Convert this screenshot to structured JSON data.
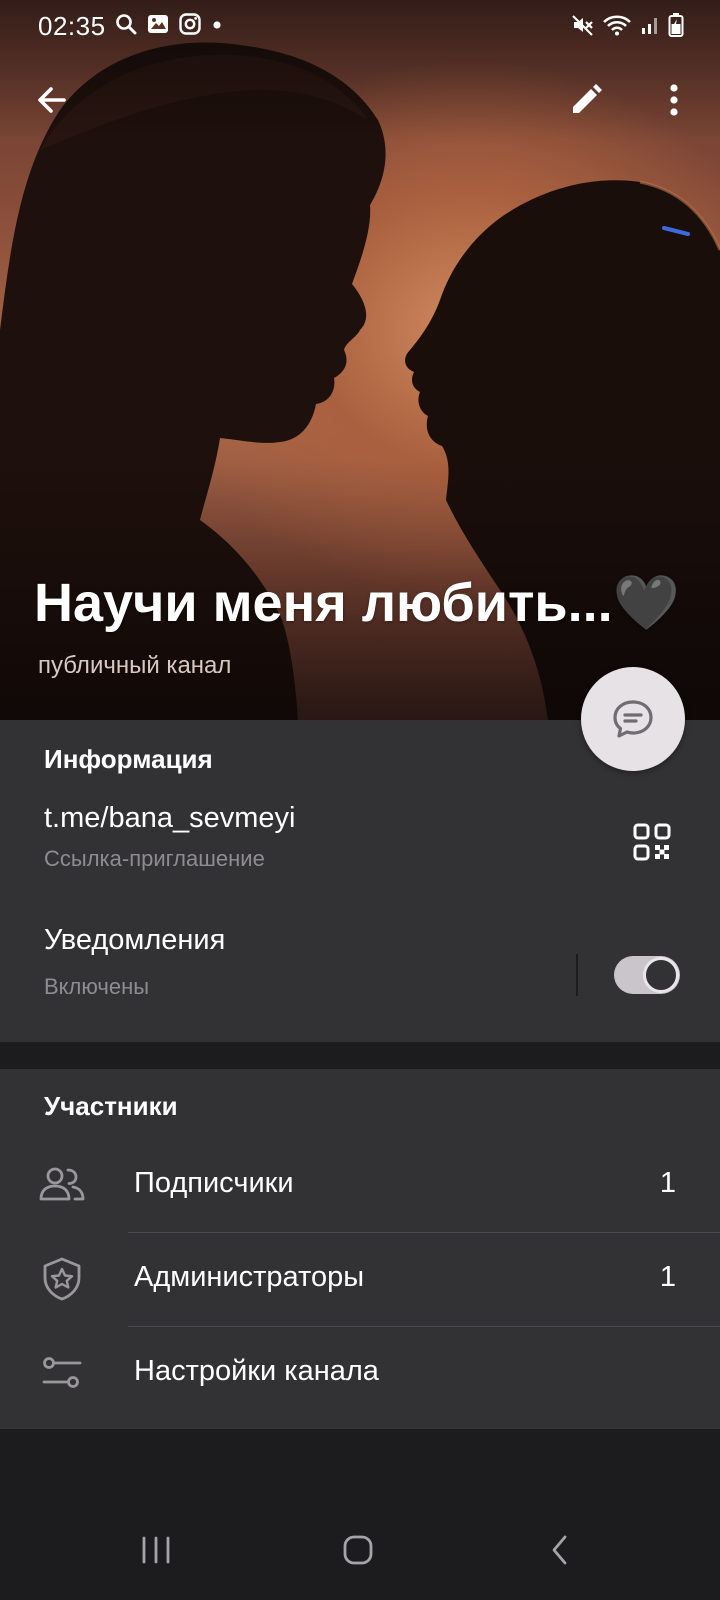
{
  "status_bar": {
    "time": "02:35",
    "left_icons": [
      "search-icon",
      "gallery-icon",
      "instagram-icon",
      "dot-icon"
    ],
    "right_icons": [
      "mute-icon",
      "wifi-icon",
      "signal-icon",
      "battery-icon"
    ]
  },
  "app_bar": {
    "back_icon": "arrow-back-icon",
    "edit_icon": "pencil-icon",
    "more_icon": "more-vertical-icon"
  },
  "channel": {
    "title": "Научи меня любить...🖤",
    "subtitle": "публичный канал"
  },
  "info_section": {
    "title": "Информация",
    "link": "t.me/bana_sevmeyi",
    "link_caption": "Ссылка-приглашение",
    "notifications_label": "Уведомления",
    "notifications_status": "Включены",
    "notifications_enabled": true
  },
  "members_section": {
    "title": "Участники",
    "items": [
      {
        "label": "Подписчики",
        "count": "1",
        "icon": "people-icon"
      },
      {
        "label": "Администраторы",
        "count": "1",
        "icon": "shield-star-icon"
      },
      {
        "label": "Настройки канала",
        "count": "",
        "icon": "sliders-icon"
      }
    ]
  },
  "colors": {
    "surface": "#323134",
    "background": "#1c1c1e",
    "secondary_text": "#8e8c91",
    "fab": "#e6e2e6"
  }
}
